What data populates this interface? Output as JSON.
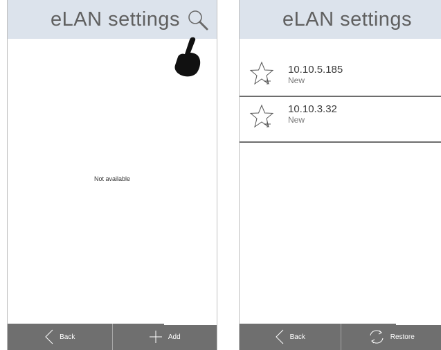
{
  "left_screen": {
    "header": {
      "title": "eLAN settings",
      "search_icon": "search-icon"
    },
    "empty_message": "Not available",
    "footer": {
      "back_label": "Back",
      "back_icon": "chevron-left-icon",
      "add_label": "Add",
      "add_icon": "plus-icon"
    }
  },
  "right_screen": {
    "header": {
      "title": "eLAN settings"
    },
    "devices": [
      {
        "address": "10.10.5.185",
        "status": "New",
        "icon": "star-add-icon"
      },
      {
        "address": "10.10.3.32",
        "status": "New",
        "icon": "star-add-icon"
      }
    ],
    "footer": {
      "back_label": "Back",
      "back_icon": "chevron-left-icon",
      "restore_label": "Restore",
      "restore_icon": "refresh-icon"
    }
  },
  "colors": {
    "header_bg": "#dce3ec",
    "header_text": "#606060",
    "footer_bg": "#6f6f6f",
    "divider": "#6d6d6d"
  }
}
